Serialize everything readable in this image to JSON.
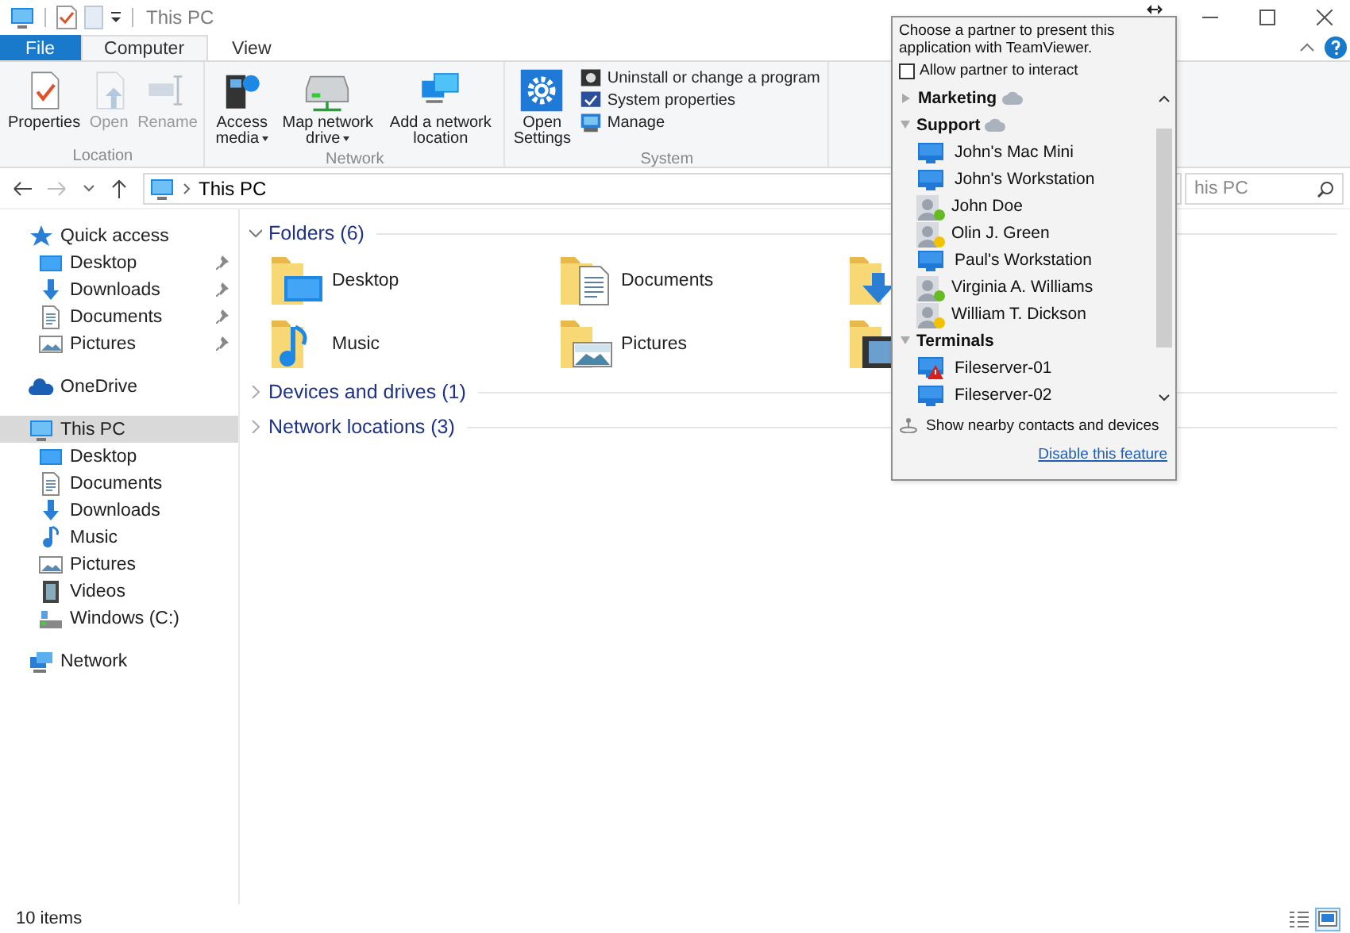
{
  "window": {
    "title": "This PC"
  },
  "ribbon": {
    "tabs": [
      {
        "label": "File",
        "kind": "file",
        "selected": false
      },
      {
        "label": "Computer",
        "kind": "tab",
        "selected": true
      },
      {
        "label": "View",
        "kind": "tab",
        "selected": false
      }
    ],
    "groups": [
      {
        "label": "Location",
        "buttons": [
          {
            "label": "Properties",
            "kind": "properties",
            "disabled": false,
            "dropdown": false
          },
          {
            "label": "Open",
            "kind": "open",
            "disabled": true,
            "dropdown": false
          },
          {
            "label": "Rename",
            "kind": "rename",
            "disabled": true,
            "dropdown": false
          }
        ]
      },
      {
        "label": "Network",
        "buttons": [
          {
            "label": "Access media",
            "kind": "media",
            "disabled": false,
            "dropdown": true
          },
          {
            "label": "Map network drive",
            "kind": "map-drive",
            "disabled": false,
            "dropdown": true
          },
          {
            "label": "Add a network location",
            "kind": "add-location",
            "disabled": false,
            "dropdown": false
          }
        ]
      },
      {
        "label": "System",
        "buttons": [
          {
            "label": "Open Settings",
            "kind": "settings",
            "disabled": false,
            "dropdown": false
          }
        ],
        "small_buttons": [
          {
            "label": "Uninstall or change a program",
            "kind": "uninstall"
          },
          {
            "label": "System properties",
            "kind": "sysprops"
          },
          {
            "label": "Manage",
            "kind": "manage"
          }
        ]
      }
    ]
  },
  "address": {
    "path": "This PC",
    "search_placeholder": "his PC"
  },
  "sidebar": {
    "items": [
      {
        "label": "Quick access",
        "kind": "star",
        "selected": false,
        "children": [
          {
            "label": "Desktop",
            "kind": "desktop",
            "pinned": true,
            "selected": false
          },
          {
            "label": "Downloads",
            "kind": "downloads",
            "pinned": true,
            "selected": false
          },
          {
            "label": "Documents",
            "kind": "documents",
            "pinned": true,
            "selected": false
          },
          {
            "label": "Pictures",
            "kind": "pictures",
            "pinned": true,
            "selected": false
          }
        ]
      },
      {
        "label": "OneDrive",
        "kind": "cloud",
        "selected": false
      },
      {
        "label": "This PC",
        "kind": "pc",
        "selected": true,
        "children": [
          {
            "label": "Desktop",
            "kind": "desktop",
            "pinned": false,
            "selected": false
          },
          {
            "label": "Documents",
            "kind": "documents",
            "pinned": false,
            "selected": false
          },
          {
            "label": "Downloads",
            "kind": "downloads",
            "pinned": false,
            "selected": false
          },
          {
            "label": "Music",
            "kind": "music",
            "pinned": false,
            "selected": false
          },
          {
            "label": "Pictures",
            "kind": "pictures",
            "pinned": false,
            "selected": false
          },
          {
            "label": "Videos",
            "kind": "videos",
            "pinned": false,
            "selected": false
          },
          {
            "label": "Windows (C:)",
            "kind": "drive",
            "pinned": false,
            "selected": false
          }
        ]
      },
      {
        "label": "Network",
        "kind": "network",
        "selected": false
      }
    ]
  },
  "content": {
    "sections": [
      {
        "title": "Folders (6)",
        "expanded": true,
        "items": [
          {
            "label": "Desktop",
            "kind": "desktop"
          },
          {
            "label": "Documents",
            "kind": "documents"
          },
          {
            "kind": "downloads"
          },
          {
            "label": "Music",
            "kind": "music"
          },
          {
            "label": "Pictures",
            "kind": "pictures"
          },
          {
            "kind": "videos"
          }
        ]
      },
      {
        "title": "Devices and drives (1)",
        "expanded": false
      },
      {
        "title": "Network locations (3)",
        "expanded": false
      }
    ]
  },
  "teamviewer_popup": {
    "prompt": "Choose a partner to present this application with TeamViewer.",
    "allow_interact": {
      "label": "Allow partner to interact",
      "checked": false
    },
    "groups": [
      {
        "label": "Marketing",
        "cloud": true,
        "expanded": false
      },
      {
        "label": "Support",
        "cloud": true,
        "expanded": true,
        "contacts": [
          {
            "name": "John's Mac Mini",
            "kind": "computer"
          },
          {
            "name": "John's Workstation",
            "kind": "computer"
          },
          {
            "name": "John Doe",
            "kind": "person",
            "color": "#66bb22"
          },
          {
            "name": "Olin J. Green",
            "kind": "person",
            "color": "#f2c200"
          },
          {
            "name": "Paul's Workstation",
            "kind": "computer"
          },
          {
            "name": "Virginia A. Williams",
            "kind": "person",
            "color": "#66bb22"
          },
          {
            "name": "William T. Dickson",
            "kind": "person",
            "color": "#f2c200"
          }
        ]
      },
      {
        "label": "Terminals",
        "cloud": false,
        "expanded": true,
        "contacts": [
          {
            "name": "Fileserver-01",
            "kind": "computer-alert"
          },
          {
            "name": "Fileserver-02",
            "kind": "computer"
          }
        ]
      }
    ],
    "nearby": "Show nearby contacts and devices",
    "disable_link": "Disable this feature"
  },
  "status_bar": {
    "count": "10 items",
    "views": [
      {
        "kind": "details",
        "selected": false
      },
      {
        "kind": "large-icons",
        "selected": true
      }
    ]
  }
}
